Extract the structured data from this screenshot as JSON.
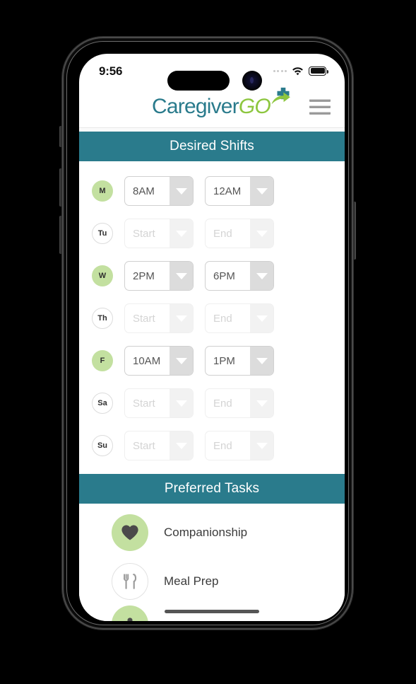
{
  "status_bar": {
    "time": "9:56",
    "signal_icon": "signal-dots-icon",
    "wifi_icon": "wifi-icon",
    "battery_icon": "battery-full-icon"
  },
  "app_header": {
    "logo_primary": "Caregiver",
    "logo_secondary": "GO",
    "logo_mark_icon": "medical-cross-arrow-icon",
    "menu_icon": "hamburger-menu-icon"
  },
  "sections": {
    "shifts_title": "Desired Shifts",
    "tasks_title": "Preferred Tasks"
  },
  "shifts": {
    "start_placeholder": "Start",
    "end_placeholder": "End",
    "rows": [
      {
        "day": "M",
        "active": true,
        "start": "8AM",
        "end": "12AM"
      },
      {
        "day": "Tu",
        "active": false,
        "start": "",
        "end": ""
      },
      {
        "day": "W",
        "active": true,
        "start": "2PM",
        "end": "6PM"
      },
      {
        "day": "Th",
        "active": false,
        "start": "",
        "end": ""
      },
      {
        "day": "F",
        "active": true,
        "start": "10AM",
        "end": "1PM"
      },
      {
        "day": "Sa",
        "active": false,
        "start": "",
        "end": ""
      },
      {
        "day": "Su",
        "active": false,
        "start": "",
        "end": ""
      }
    ]
  },
  "tasks": [
    {
      "label": "Companionship",
      "icon": "heart-icon",
      "selected": true
    },
    {
      "label": "Meal Prep",
      "icon": "fork-knife-icon",
      "selected": false
    },
    {
      "label": "",
      "icon": "person-icon",
      "selected": true
    }
  ],
  "colors": {
    "teal": "#2A7B8C",
    "green": "#8DC63F",
    "light_green": "#C3E0A0",
    "text_dark": "#3B3B3B"
  }
}
